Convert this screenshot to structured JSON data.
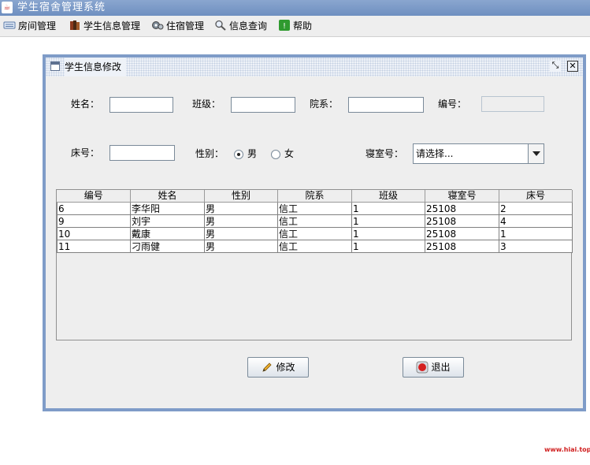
{
  "app": {
    "title": "学生宿舍管理系统"
  },
  "menu": {
    "rooms": "房间管理",
    "student": "学生信息管理",
    "stay": "住宿管理",
    "query": "信息查询",
    "help": "帮助"
  },
  "frame": {
    "title": "学生信息修改"
  },
  "form": {
    "name_label": "姓名：",
    "name_value": "",
    "class_label": "班级：",
    "class_value": "",
    "dept_label": "院系：",
    "dept_value": "",
    "id_label": "编号：",
    "id_value": "",
    "bed_label": "床号：",
    "bed_value": "",
    "gender_label": "性别：",
    "gender_male": "男",
    "gender_female": "女",
    "gender_selected": "男",
    "room_label": "寝室号：",
    "room_selected": "请选择..."
  },
  "table": {
    "headers": [
      "编号",
      "姓名",
      "性别",
      "院系",
      "班级",
      "寝室号",
      "床号"
    ],
    "rows": [
      [
        "6",
        "李华阳",
        "男",
        "信工",
        "1",
        "25108",
        "2"
      ],
      [
        "9",
        "刘宇",
        "男",
        "信工",
        "1",
        "25108",
        "4"
      ],
      [
        "10",
        "戴康",
        "男",
        "信工",
        "1",
        "25108",
        "1"
      ],
      [
        "11",
        "刁雨健",
        "男",
        "信工",
        "1",
        "25108",
        "3"
      ]
    ]
  },
  "buttons": {
    "modify": "修改",
    "exit": "退出"
  },
  "watermark": "www.hiai.top",
  "colors": {
    "titlebar": "#7f9cc8",
    "frame_border": "#7f9cc8",
    "watermark": "#d02020"
  }
}
